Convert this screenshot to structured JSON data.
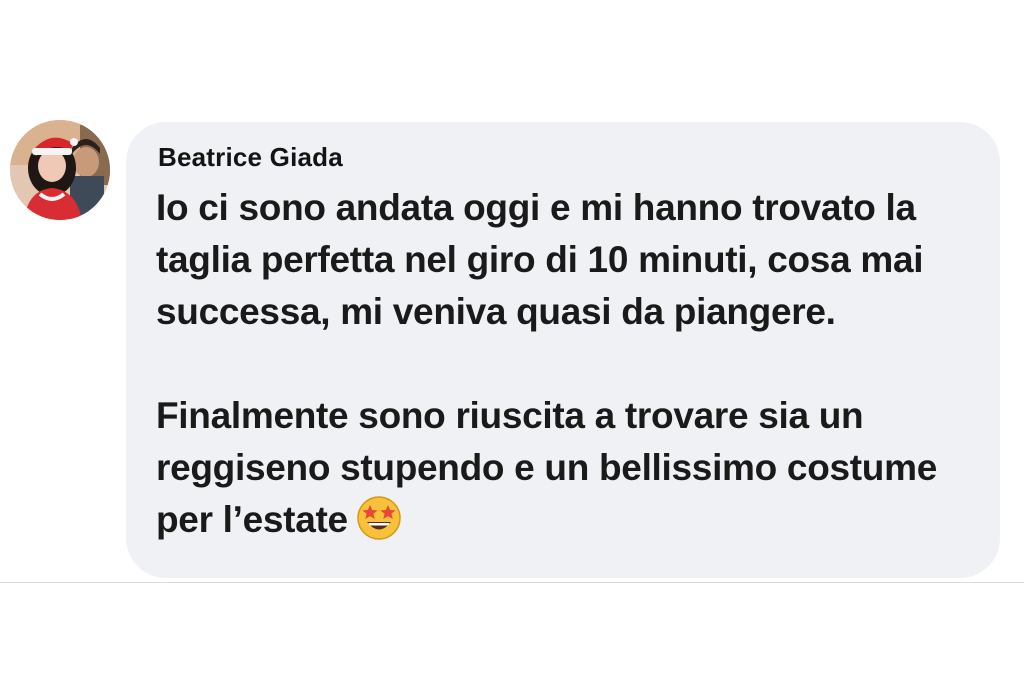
{
  "comment": {
    "author": "Beatrice Giada",
    "paragraphs": [
      "Io ci sono andata oggi e mi hanno trovato la taglia perfetta nel giro di 10 minuti, cosa mai successa, mi veniva quasi da piangere.",
      "Finalmente sono riuscita a trovare sia un reggiseno stupendo e un bellissimo costume per l’estate"
    ],
    "reaction_icon": "star-struck-emoji-icon",
    "avatar_icon": "profile-photo-avatar"
  },
  "colors": {
    "bubble": "#eff1f4",
    "text": "#1a1a1a",
    "background": "#ffffff"
  }
}
